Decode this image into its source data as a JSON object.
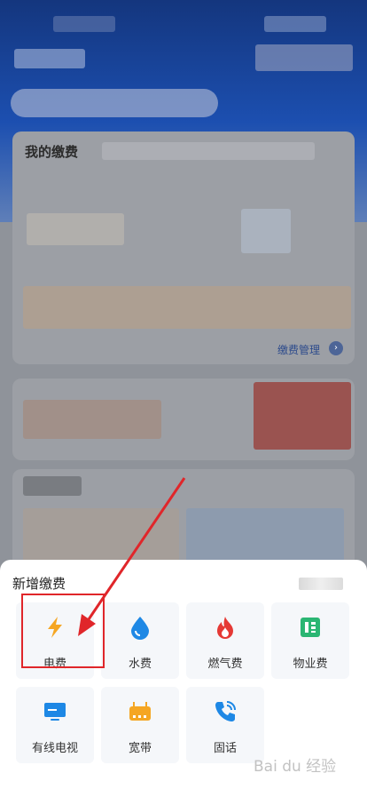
{
  "background": {
    "card_title": "我的缴费",
    "manage_link": "缴费管理",
    "manage_arrow": "›"
  },
  "sheet": {
    "title": "新增缴费",
    "items": [
      {
        "label": "电费",
        "icon": "lightning-icon",
        "color": "#f5a623"
      },
      {
        "label": "水费",
        "icon": "water-drop-icon",
        "color": "#1e88e5"
      },
      {
        "label": "燃气费",
        "icon": "flame-icon",
        "color": "#e53935"
      },
      {
        "label": "物业费",
        "icon": "property-doc-icon",
        "color": "#2bb673"
      },
      {
        "label": "有线电视",
        "icon": "tv-icon",
        "color": "#1e88e5"
      },
      {
        "label": "宽带",
        "icon": "router-icon",
        "color": "#f5a623"
      },
      {
        "label": "固话",
        "icon": "phone-icon",
        "color": "#1e88e5"
      }
    ]
  },
  "annotation": {
    "highlight_color": "#e0262a"
  },
  "watermark": {
    "text": "Bai du 经验"
  }
}
